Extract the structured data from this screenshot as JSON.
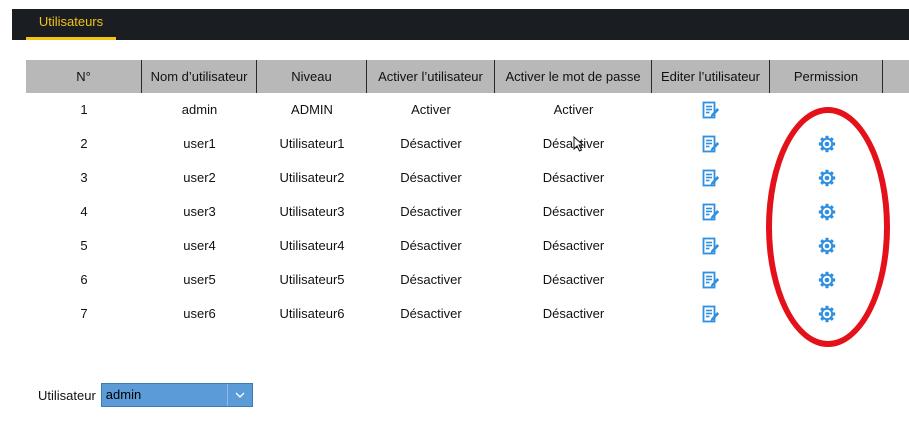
{
  "header": {
    "tab_label": "Utilisateurs"
  },
  "table": {
    "columns": [
      "N°",
      "Nom d’utilisateur",
      "Niveau",
      "Activer l’utilisateur",
      "Activer le mot de passe",
      "Editer l’utilisateur",
      "Permission",
      ""
    ],
    "rows": [
      {
        "num": "1",
        "name": "admin",
        "level": "ADMIN",
        "user_status": "Activer",
        "pwd_status": "Activer",
        "has_permission": false
      },
      {
        "num": "2",
        "name": "user1",
        "level": "Utilisateur1",
        "user_status": "Désactiver",
        "pwd_status": "Désactiver",
        "has_permission": true
      },
      {
        "num": "3",
        "name": "user2",
        "level": "Utilisateur2",
        "user_status": "Désactiver",
        "pwd_status": "Désactiver",
        "has_permission": true
      },
      {
        "num": "4",
        "name": "user3",
        "level": "Utilisateur3",
        "user_status": "Désactiver",
        "pwd_status": "Désactiver",
        "has_permission": true
      },
      {
        "num": "5",
        "name": "user4",
        "level": "Utilisateur4",
        "user_status": "Désactiver",
        "pwd_status": "Désactiver",
        "has_permission": true
      },
      {
        "num": "6",
        "name": "user5",
        "level": "Utilisateur5",
        "user_status": "Désactiver",
        "pwd_status": "Désactiver",
        "has_permission": true
      },
      {
        "num": "7",
        "name": "user6",
        "level": "Utilisateur6",
        "user_status": "Désactiver",
        "pwd_status": "Désactiver",
        "has_permission": true
      }
    ]
  },
  "user_selector": {
    "label": "Utilisateur",
    "value": "admin"
  },
  "icons": {
    "edit": "edit-icon",
    "permission": "gear-icon",
    "dropdown": "chevron-down-icon"
  },
  "colors": {
    "accent": "#f3c315",
    "icon_blue": "#2f8fe0",
    "annotation": "#e4111b",
    "select_bg": "#5b9bd8",
    "header_bg": "#b8b8b8"
  }
}
